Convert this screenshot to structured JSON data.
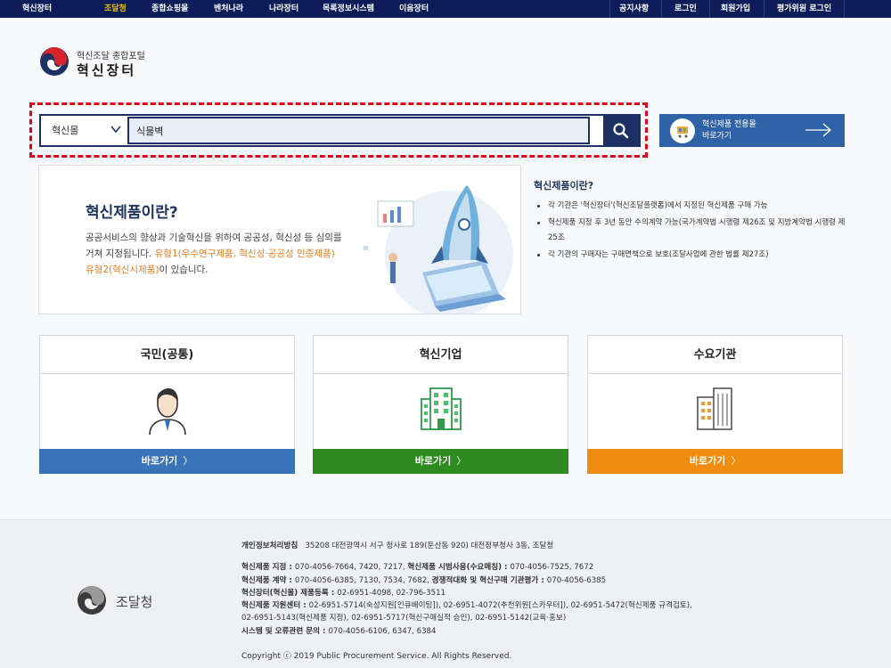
{
  "topnav": {
    "left_items": [
      "혁신장터",
      "조달청",
      "종합쇼핑몰",
      "벤처나라",
      "나라장터",
      "목록정보시스템",
      "이음장터"
    ],
    "right_items": [
      "공지사항",
      "로그인",
      "회원가입",
      "평가위원 로그인"
    ],
    "active_color": "#f5c400"
  },
  "logo": {
    "subtitle": "혁신조달 종합포털",
    "title": "혁신장터"
  },
  "search": {
    "category": "혁신몰",
    "value": "식물벽",
    "button_icon": "search-icon"
  },
  "shortcut": {
    "label": "혁신제품 전용몰\n바로가기",
    "icon": "cart-icon"
  },
  "banner": {
    "title": "혁신제품이란?",
    "line1": "공공서비스의 향상과 기술혁신을 위하여 공공성, 혁신성 등 심의를",
    "line2_a": "거쳐 지정됩니다. ",
    "line2_b": "유형1(우수연구제품, 혁신성·공공성 인증제품)",
    "line3_a": "유형2(혁신시제품)",
    "line3_b": "이 있습니다."
  },
  "info": {
    "title": "혁신제품이란?",
    "items": [
      "각 기관은 '혁신장터'(혁신조달플랫폼)에서 지정된 혁신제품 구매 가능",
      "혁신제품 지정 후 3년 동안 수의계약 가능(국가계약법 시행령 제26조 및 지방계약법 시행령 제25조",
      "각 기관의 구매자는 구매면책으로 보호(조달사업에 관한 법률 제27조)"
    ]
  },
  "cards": [
    {
      "title": "국민(공통)",
      "button": "바로가기",
      "color": "#3a74b8",
      "icon": "person-icon"
    },
    {
      "title": "혁신기업",
      "button": "바로가기",
      "color": "#2e8b1f",
      "icon": "building-icon"
    },
    {
      "title": "수요기관",
      "button": "바로가기",
      "color": "#f08c10",
      "icon": "office-building-icon"
    }
  ],
  "footer": {
    "logo_text": "조달청",
    "privacy_label": "개인정보처리방침",
    "address": "35208 대전광역시 서구 청사로 189(둔산동 920) 대전정부청사 3동, 조달청",
    "r1_l1": "혁신제품 지정 : ",
    "r1_v1": "070-4056-7664, 7420, 7217, ",
    "r1_l2": "혁신제품 시범사용(수요매칭) : ",
    "r1_v2": "070-4056-7525, 7672",
    "r2_l1": "혁신제품 계약 : ",
    "r2_v1": "070-4056-6385, 7130, 7534, 7682, ",
    "r2_l2": "경쟁적대화 및 혁신구매 기관평가 : ",
    "r2_v2": "070-4056-6385",
    "r3_l1": "혁신장터(혁신몰) 제품등록 : ",
    "r3_v1": "02-6951-4098, 02-796-3511",
    "r4_l1": "혁신제품 지원센터 : ",
    "r4_v1": "02-6951-5714(숙성지원[인큐베이팅]), 02-6951-4072(추천위원[스카우터]), 02-6951-5472(혁신제품 규격검토),",
    "r5_v1": "02-6951-5143(혁신제품 지정), 02-6951-5717(혁신구매실적 승인), 02-6951-5142(교육·홍보)",
    "r6_l1": "시스템 및 오류관련 문의 : ",
    "r6_v1": "070-4056-6106, 6347, 6384",
    "copyright": "Copyright ⓒ 2019 Public Procurement Service. All Rights Reserved."
  }
}
